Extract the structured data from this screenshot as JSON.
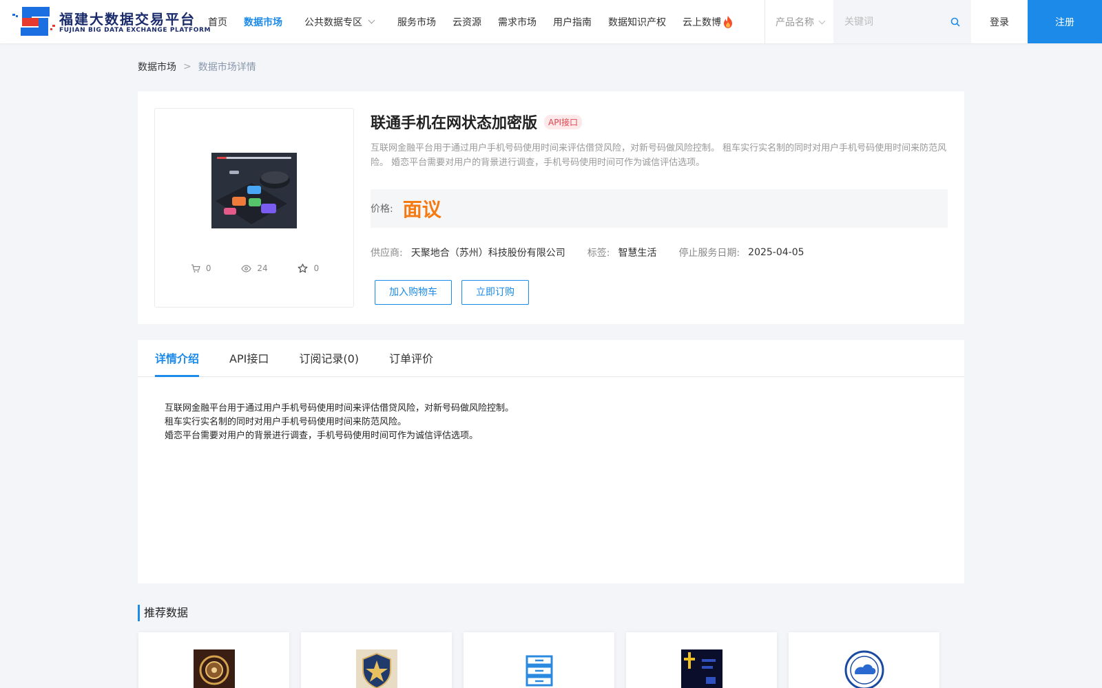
{
  "header": {
    "logo_title": "福建大数据交易平台",
    "logo_subtitle": "FUJIAN BIG DATA EXCHANGE  PLATFORM",
    "nav": [
      {
        "label": "首页",
        "active": false
      },
      {
        "label": "数据市场",
        "active": true
      },
      {
        "label": "公共数据专区",
        "active": false,
        "dropdown": true
      },
      {
        "label": "服务市场",
        "active": false
      },
      {
        "label": "云资源",
        "active": false
      },
      {
        "label": "需求市场",
        "active": false
      },
      {
        "label": "用户指南",
        "active": false
      },
      {
        "label": "数据知识产权",
        "active": false
      },
      {
        "label": "云上数博",
        "active": false,
        "icon": "fire-icon"
      }
    ],
    "search_category": "产品名称",
    "search_placeholder": "关键词",
    "search_value": "",
    "login_label": "登录",
    "register_label": "注册",
    "accent_color": "#1b8ae8"
  },
  "breadcrumb": {
    "home": "数据市场",
    "separator": ">",
    "current": "数据市场详情"
  },
  "product": {
    "title": "联通手机在网状态加密版",
    "badge": "API接口",
    "description": "互联网金融平台用于通过用户手机号码使用时间来评估借贷风险，对新号码做风险控制。 租车实行实名制的同时对用户手机号码使用时间来防范风险。 婚恋平台需要对用户的背景进行调查，手机号码使用时间可作为诚信评估选项。",
    "price_label": "价格:",
    "price_value": "面议",
    "price_color": "#f57a12",
    "stats": {
      "cart_count": "0",
      "view_count": "24",
      "favorite_count": "0"
    },
    "supplier_label": "供应商:",
    "supplier_value": "天聚地合（苏州）科技股份有限公司",
    "tag_label": "标签:",
    "tag_value": "智慧生活",
    "end_date_label": "停止服务日期:",
    "end_date_value": "2025-04-05",
    "add_cart_label": "加入购物车",
    "subscribe_label": "立即订购"
  },
  "tabs": [
    {
      "label": "详情介绍",
      "active": true
    },
    {
      "label": "API接口",
      "active": false
    },
    {
      "label": "订阅记录(0)",
      "active": false
    },
    {
      "label": "订单评价",
      "active": false
    }
  ],
  "detail_lines": [
    "互联网金融平台用于通过用户手机号码使用时间来评估借贷风险，对新号码做风险控制。",
    "租车实行实名制的同时对用户手机号码使用时间来防范风险。",
    "婚恋平台需要对用户的背景进行调查，手机号码使用时间可作为诚信评估选项。"
  ],
  "recommend": {
    "title": "推荐数据",
    "items": [
      {
        "icon": "gold-emblem-icon"
      },
      {
        "icon": "shield-emblem-icon"
      },
      {
        "icon": "server-icon"
      },
      {
        "icon": "dark-logo-icon"
      },
      {
        "icon": "weather-seal-icon"
      }
    ]
  }
}
